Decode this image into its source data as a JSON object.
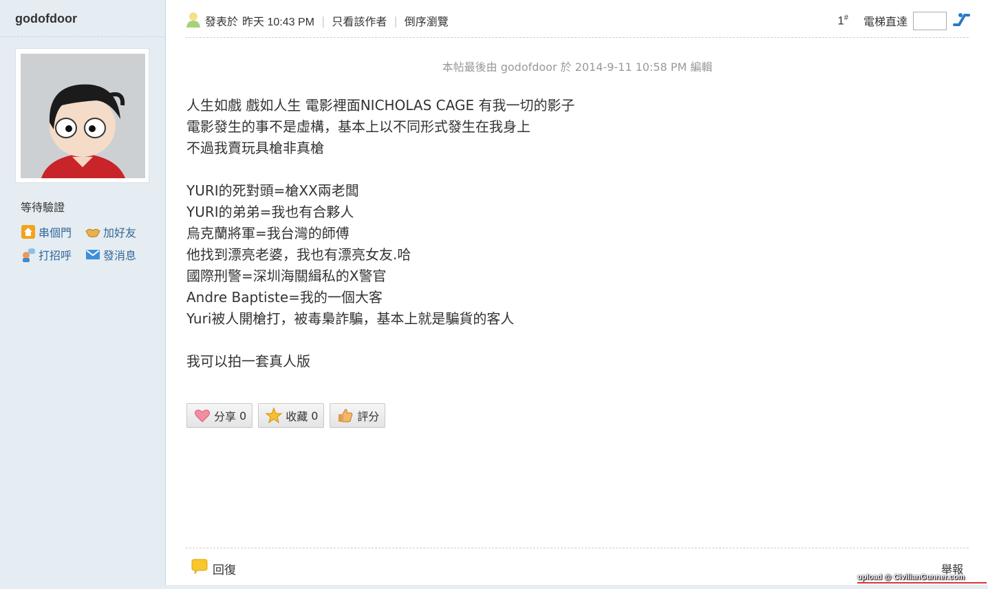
{
  "sidebar": {
    "username": "godofdoor",
    "status": "等待驗證",
    "links": [
      {
        "label": "串個門",
        "icon": "home-icon"
      },
      {
        "label": "加好友",
        "icon": "handshake-icon"
      },
      {
        "label": "打招呼",
        "icon": "greet-icon"
      },
      {
        "label": "發消息",
        "icon": "mail-icon"
      }
    ]
  },
  "post_header": {
    "posted_label": "發表於",
    "posted_time": "昨天 10:43 PM",
    "author_only": "只看該作者",
    "reverse_view": "倒序瀏覽",
    "floor": "1",
    "floor_mark": "#",
    "jump_label": "電梯直達"
  },
  "edit_note": "本帖最後由 godofdoor 於 2014-9-11 10:58 PM 編輯",
  "content_lines": [
    "人生如戲 戲如人生 電影裡面NICHOLAS CAGE 有我一切的影子",
    "電影發生的事不是虛構，基本上以不同形式發生在我身上",
    "不過我賣玩具槍非真槍",
    "",
    "YURI的死對頭=槍XX兩老闆",
    "YURI的弟弟=我也有合夥人",
    "烏克蘭將軍=我台灣的師傅",
    "他找到漂亮老婆，我也有漂亮女友.哈",
    "國際刑警=深圳海關緝私的X警官",
    "Andre Baptiste=我的一個大客",
    "Yuri被人開槍打，被毒梟詐騙，基本上就是騙貨的客人",
    "",
    "我可以拍一套真人版"
  ],
  "actions": {
    "share_label": "分享",
    "share_count": "0",
    "favorite_label": "收藏",
    "favorite_count": "0",
    "rate_label": "評分"
  },
  "footer": {
    "reply_label": "回復",
    "report_label": "舉報",
    "watermark": "upload @ CivilianGunner.com"
  }
}
